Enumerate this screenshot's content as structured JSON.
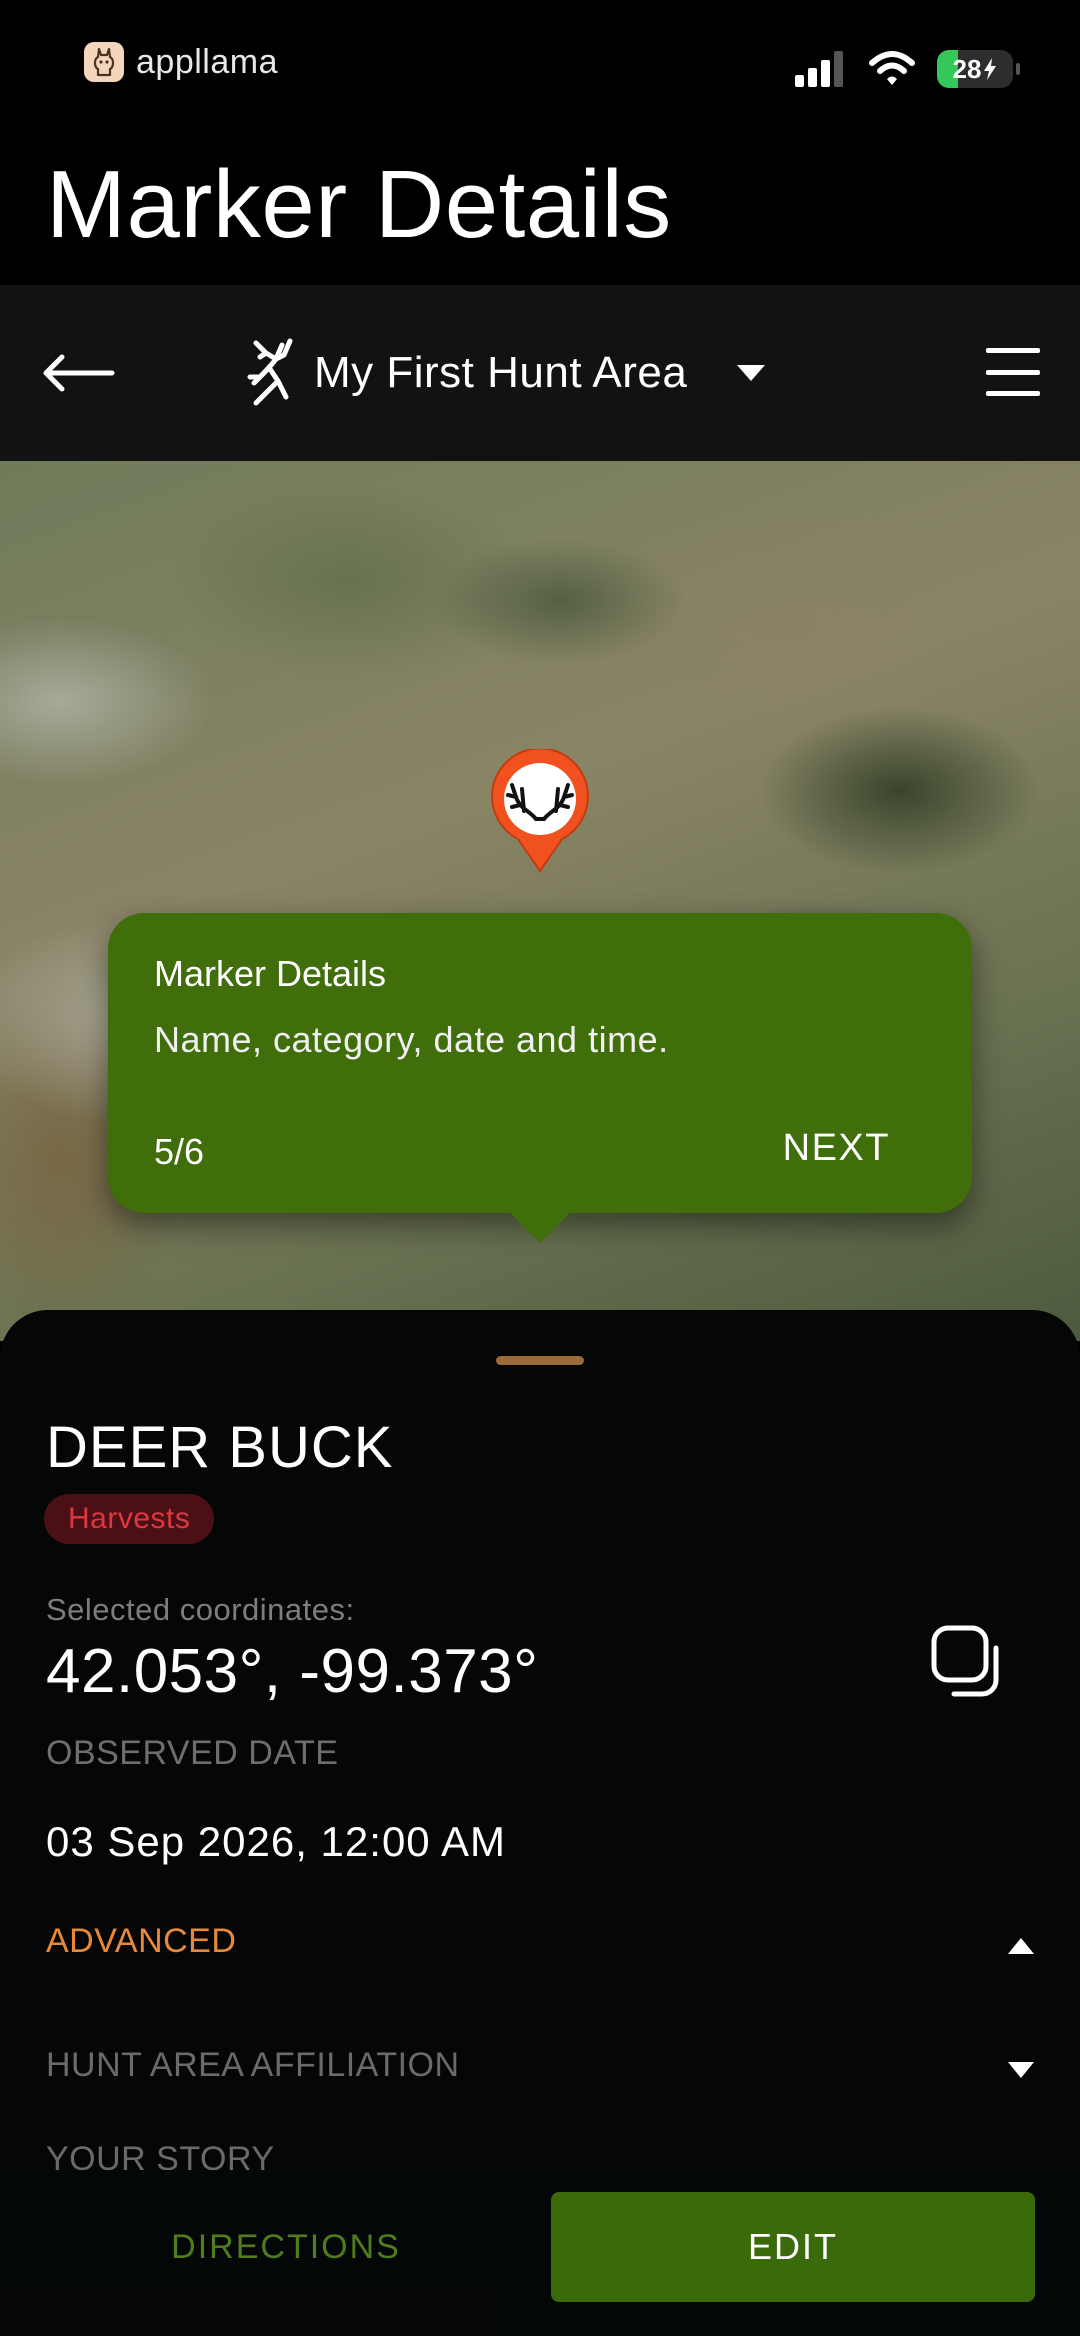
{
  "status_bar": {
    "carrier": "appllama",
    "battery": "28",
    "battery_level": 0.28,
    "icons": [
      "cellular-signal-icon",
      "wifi-icon",
      "battery-charging-icon"
    ]
  },
  "page_title": "Marker Details",
  "toolbar": {
    "area_name": "My First Hunt Area",
    "icons": [
      "back-arrow-icon",
      "deer-hunter-logo-icon",
      "caret-down-icon",
      "hamburger-menu-icon"
    ]
  },
  "map": {
    "marker_icon": "antlers-icon",
    "marker_color": "#f0511e"
  },
  "tooltip": {
    "title": "Marker Details",
    "description": "Name, category, date and time.",
    "step": "5/6",
    "next_label": "NEXT",
    "color": "#3f6e0b"
  },
  "details": {
    "name": "DEER BUCK",
    "category": "Harvests",
    "category_color": "#e0363f",
    "coordinates_label": "Selected coordinates:",
    "coordinates": "42.053°, -99.373°",
    "copy_icon": "copy-icon",
    "observed_date_label": "OBSERVED DATE",
    "observed_date": "03 Sep 2026, 12:00 AM",
    "advanced_label": "ADVANCED",
    "advanced_expanded": true,
    "hunt_area_affiliation_label": "HUNT AREA AFFILIATION",
    "your_story_label": "YOUR STORY",
    "accent_color": "#e8893a"
  },
  "actions": {
    "directions_label": "DIRECTIONS",
    "edit_label": "EDIT",
    "primary_color": "#3b6a0a"
  }
}
